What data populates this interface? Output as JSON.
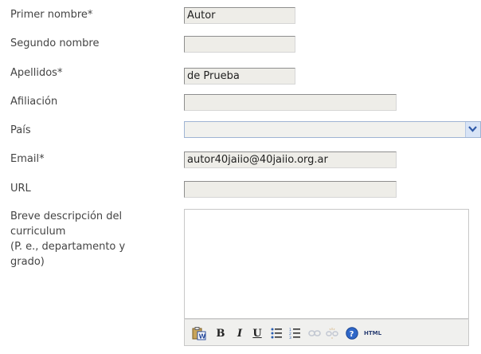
{
  "form": {
    "first_name": {
      "label": "Primer nombre*",
      "value": "Autor"
    },
    "middle_name": {
      "label": "Segundo nombre",
      "value": ""
    },
    "last_name": {
      "label": "Apellidos*",
      "value": "de Prueba"
    },
    "affiliation": {
      "label": "Afiliación",
      "value": ""
    },
    "country": {
      "label": "País",
      "value": ""
    },
    "email": {
      "label": "Email*",
      "value": "autor40jaiio@40jaiio.org.ar"
    },
    "url": {
      "label": "URL",
      "value": ""
    },
    "bio": {
      "label_lines": [
        "Breve descripción del",
        "curriculum",
        "(P. e., departamento y",
        "grado)"
      ],
      "value": ""
    }
  },
  "toolbar": {
    "bold": "B",
    "italic": "I",
    "underline": "U",
    "html": "HTML",
    "icons": [
      "paste-word-icon",
      "bold-icon",
      "italic-icon",
      "underline-icon",
      "bullet-list-icon",
      "numbered-list-icon",
      "link-icon",
      "unlink-icon",
      "help-icon",
      "html-icon"
    ]
  }
}
